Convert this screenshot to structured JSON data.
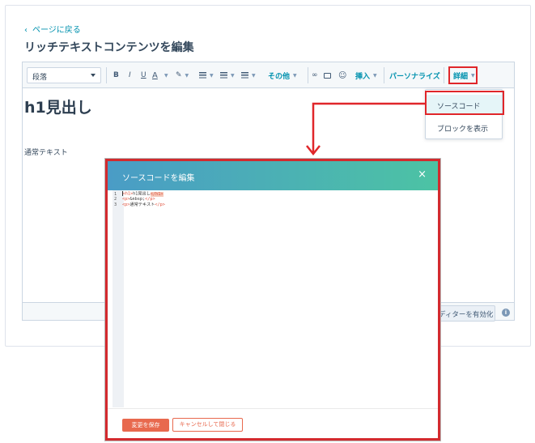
{
  "page": {
    "back_link": "ページに戻る",
    "back_chevron": "‹",
    "title": "リッチテキストコンテンツを編集"
  },
  "toolbar": {
    "paragraph_select": "段落",
    "bold": "B",
    "italic": "I",
    "underline": "U",
    "text_color": "A",
    "more_label": "その他",
    "insert_label": "挿入",
    "personalize_label": "パーソナライズ",
    "detail_label": "詳細",
    "emoji": "☺"
  },
  "content": {
    "heading": "h1見出し",
    "paragraph": "通常テキスト"
  },
  "dropdown": {
    "items": [
      "ソースコード",
      "ブロックを表示"
    ]
  },
  "editor_footer": {
    "enable_button": "ディターを有効化",
    "info_icon": "i"
  },
  "modal": {
    "title": "ソースコードを編集",
    "close": "×",
    "code_lines": [
      {
        "num": "1",
        "open": "<h1>",
        "text": "h1見出し",
        "close": "</h1>"
      },
      {
        "num": "2",
        "open": "<p>",
        "text": "&nbsp;",
        "close": "</p>"
      },
      {
        "num": "3",
        "open": "<p>",
        "text": "通常テキスト",
        "close": "</p>"
      }
    ],
    "save_button": "変更を保存",
    "cancel_button": "キャンセルして閉じる"
  },
  "colors": {
    "accent_teal": "#0091ae",
    "highlight_red": "#e0262a",
    "modal_gradient_start": "#4a9cc6",
    "modal_gradient_end": "#4cc3a4",
    "save_orange": "#e8694e"
  }
}
